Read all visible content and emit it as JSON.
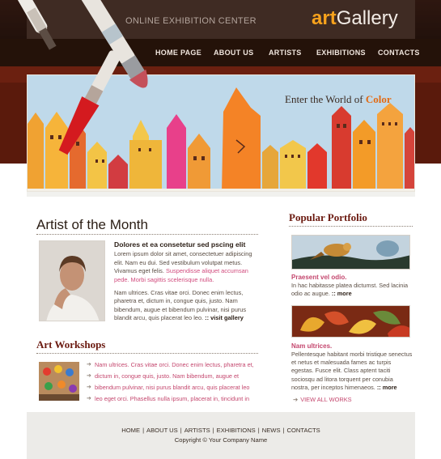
{
  "header": {
    "tagline": "ONLINE EXHIBITION CENTER",
    "logo_art": "art",
    "logo_gallery": "Gallery",
    "nav": [
      "HOME PAGE",
      "ABOUT US",
      "ARTISTS",
      "EXHIBITIONS",
      "CONTACTS"
    ]
  },
  "banner": {
    "headline_prefix": "Enter the World of ",
    "headline_accent": "Color"
  },
  "artist_of_month": {
    "title": "Artist of the Month",
    "heading": "Dolores et ea consetetur sed pscing elit",
    "para1": "Lorem ipsum dolor sit amet, consectetuer adipiscing elit. Nam eu dui. Sed vestibulum volutpat metus. Vivamus eget felis.",
    "para1_pink": "Suspendisse aliquet accumsan pede. Morbi sagittis scelerisque nulla.",
    "para2": "Nam ultrices. Cras vitae orci. Donec enim lectus, pharetra et, dictum in, congue quis, justo. Nam bibendum, augue et bibendum pulvinar, nisi purus blandit arcu, quis placerat leo leo.",
    "more_link": ":: visit gallery"
  },
  "workshops": {
    "title": "Art Workshops",
    "items": [
      "Nam ultrices. Cras vitae orci. Donec enim lectus, pharetra et,",
      "dictum in, congue quis, justo. Nam bibendum, augue et",
      "bibendum pulvinar, nisi purus blandit arcu, quis placerat leo",
      "leo eget orci. Phasellus nulla ipsum, placerat in, tincidunt in"
    ]
  },
  "portfolio": {
    "title": "Popular Portfolio",
    "items": [
      {
        "title": "Praesent vel odio.",
        "text": "In hac habitasse platea dictumst. Sed lacinia odio ac augue.",
        "more": ":: more"
      },
      {
        "title": "Nam ultrices.",
        "text": "Pellentesque habitant morbi tristique senectus et netus et malesuada fames ac turpis egestas. Fusce elit. Class aptent taciti sociosqu ad litora torquent per conubia nostra, per inceptos himenaeos.",
        "more": ":: more"
      }
    ],
    "view_all": "VIEW ALL WORKS"
  },
  "footer": {
    "links": [
      "HOME",
      "ABOUT US",
      "ARTISTS",
      "EXHIBITIONS",
      "NEWS",
      "CONTACTS"
    ],
    "copyright": "Copyright © Your Company Name"
  },
  "colors": {
    "header_dark": "#241209",
    "accent_orange": "#f7a21c",
    "accent_pink": "#c4476e",
    "title_red": "#6b1a10"
  }
}
